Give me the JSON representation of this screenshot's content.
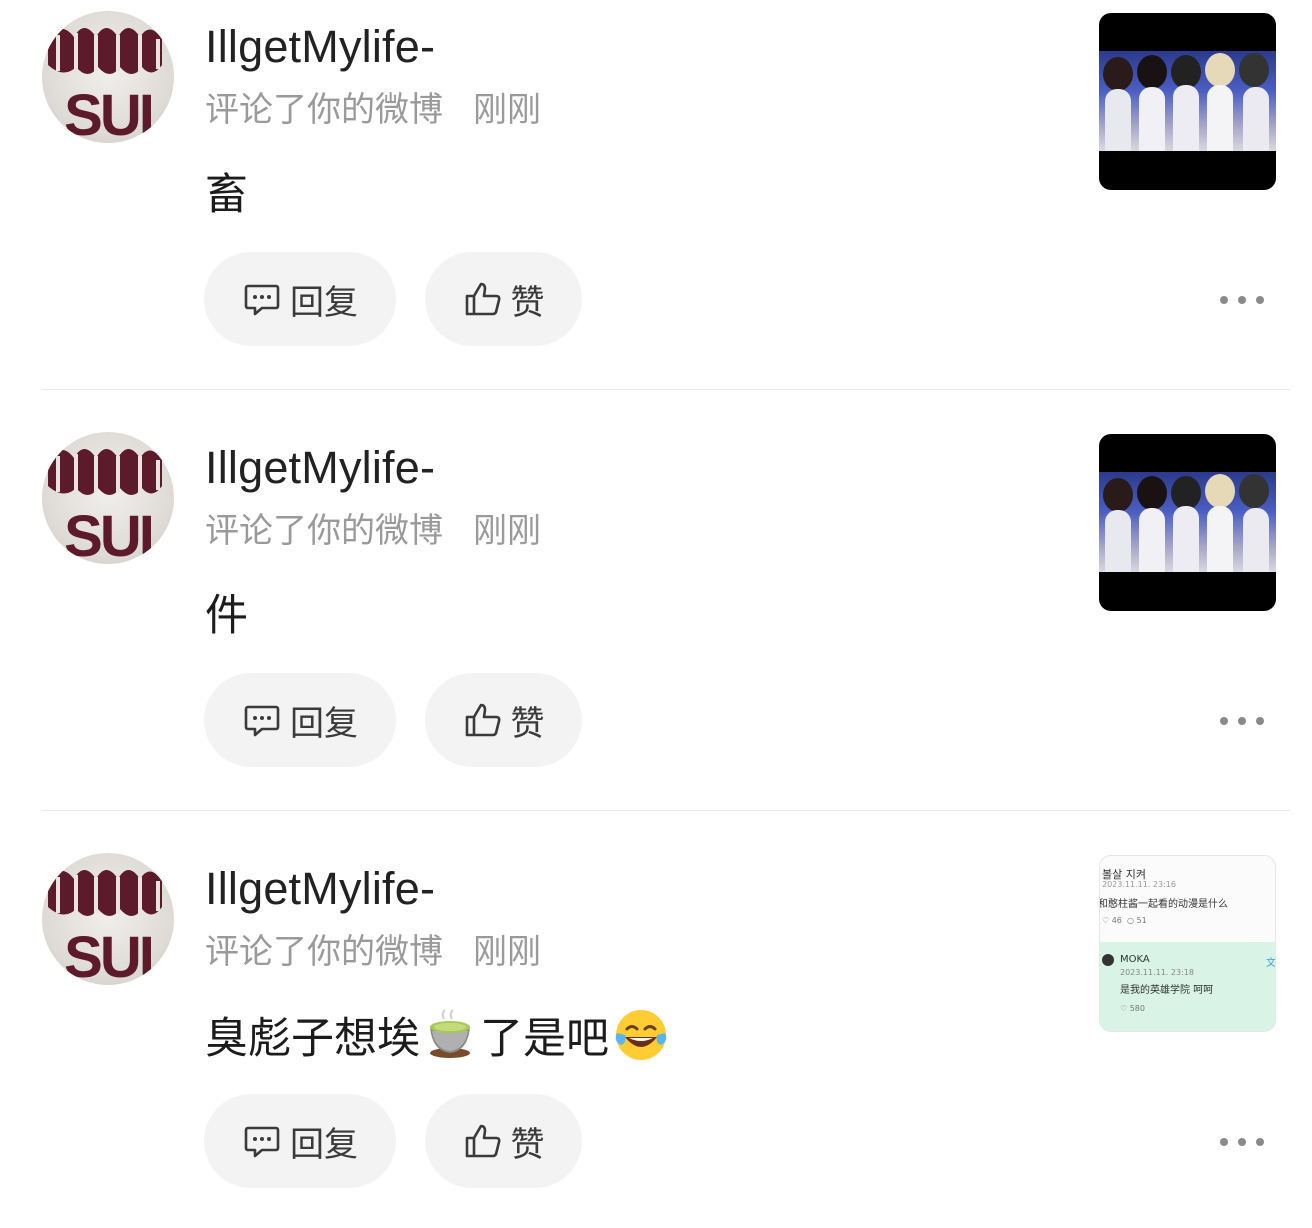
{
  "notifications": [
    {
      "user": "IllgetMylife-",
      "action": "评论了你的微博",
      "time": "刚刚",
      "comment": "畜",
      "reply_label": "回复",
      "like_label": "赞",
      "avatar_text": "SUI",
      "thumbnail": "photo-thumbnail"
    },
    {
      "user": "IllgetMylife-",
      "action": "评论了你的微博",
      "time": "刚刚",
      "comment": "件",
      "reply_label": "回复",
      "like_label": "赞",
      "avatar_text": "SUI",
      "thumbnail": "photo-thumbnail"
    },
    {
      "user": "IllgetMylife-",
      "action": "评论了你的微博",
      "time": "刚刚",
      "comment_part1": "臭彪子想埃",
      "comment_emoji1": "tea-emoji",
      "comment_part2": "了是吧",
      "comment_emoji2": "laughing-emoji",
      "reply_label": "回复",
      "like_label": "赞",
      "avatar_text": "SUI",
      "thumbnail_screenshot": {
        "top_name": "볼살 지켜",
        "top_date": "2023.11.11. 23:16",
        "top_text": "和憨柱酱一起看的动漫是什么",
        "top_likes": "46",
        "top_comments": "51",
        "reply_name": "MOKA",
        "reply_date": "2023.11.11. 23:18",
        "reply_text": "是我的英雄学院 呵呵",
        "reply_likes": "580",
        "translate_mark": "文"
      }
    }
  ],
  "icons": [
    "comment-icon",
    "thumbs-up-icon",
    "more-dots-icon"
  ],
  "colors": {
    "button_bg": "#f3f3f3",
    "meta_text": "#9a9a9a",
    "divider": "#e8e8e8",
    "avatar_text": "#5c1a2a"
  }
}
